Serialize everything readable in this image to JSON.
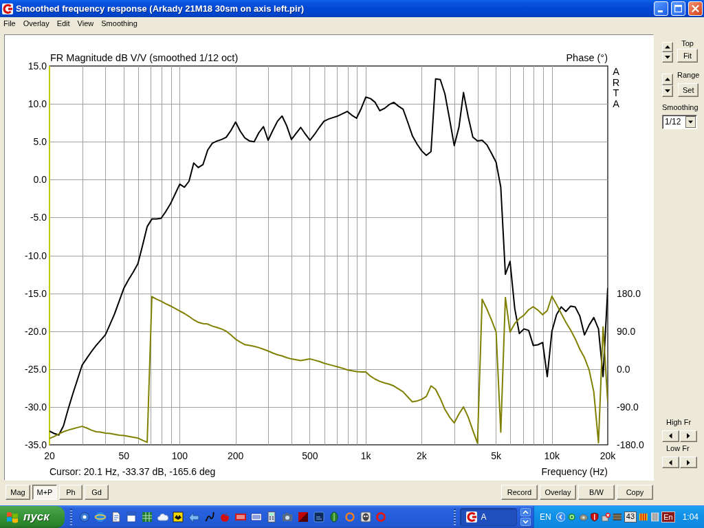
{
  "window": {
    "title": "Smoothed frequency response (Arkady 21M18 30sm on axis left.pir)"
  },
  "menu": [
    "File",
    "Overlay",
    "Edit",
    "View",
    "Smoothing"
  ],
  "chart": {
    "side_label": "ARTA",
    "cursor_readout": "Cursor: 20.1 Hz, -33.37 dB, -165.6 deg",
    "chart_data": {
      "type": "line",
      "title": "FR Magnitude dB V/V (smoothed 1/12 oct)",
      "xlabel": "Frequency (Hz)",
      "y2label": "Phase (°)",
      "grid": true,
      "categories": [
        "20",
        null,
        null,
        null,
        null,
        null,
        null,
        null,
        null,
        null,
        null,
        null,
        null,
        null,
        null,
        null,
        "50",
        null,
        null,
        null,
        null,
        null,
        null,
        null,
        null,
        null,
        null,
        null,
        "100",
        null,
        null,
        null,
        null,
        null,
        null,
        null,
        null,
        null,
        null,
        null,
        "200",
        null,
        null,
        null,
        null,
        null,
        null,
        null,
        null,
        null,
        null,
        null,
        null,
        null,
        null,
        null,
        "500",
        null,
        null,
        null,
        null,
        null,
        null,
        null,
        null,
        null,
        null,
        null,
        "1k",
        null,
        null,
        null,
        null,
        null,
        null,
        null,
        null,
        null,
        null,
        null,
        "2k",
        null,
        null,
        null,
        null,
        null,
        null,
        null,
        null,
        null,
        null,
        null,
        null,
        null,
        null,
        null,
        "5k",
        null,
        null,
        null,
        null,
        null,
        null,
        null,
        null,
        null,
        null,
        null,
        "10k",
        null,
        null,
        null,
        null,
        null,
        null,
        null,
        null,
        null,
        null,
        null,
        "20k"
      ],
      "series": [
        {
          "color": "#000000",
          "values": [
            -33.2,
            -33.5,
            -33.7,
            -32.5,
            -30.3,
            -28.3,
            -26.4,
            -24.5,
            -23.6,
            -22.7,
            -21.9,
            -21.2,
            -20.5,
            -19.1,
            -17.7,
            -16.0,
            -14.3,
            -13.2,
            -12.2,
            -11.1,
            -8.7,
            -6.2,
            -5.2,
            -5.2,
            -5.1,
            -4.2,
            -3.2,
            -1.9,
            -0.6,
            -1.0,
            -0.2,
            2.2,
            1.6,
            2.0,
            3.9,
            4.8,
            5.1,
            5.3,
            5.6,
            6.5,
            7.6,
            6.4,
            5.5,
            5.1,
            5.0,
            6.2,
            7.0,
            5.2,
            6.5,
            7.7,
            8.4,
            7.1,
            5.3,
            6.1,
            6.9,
            6.0,
            5.2,
            6.0,
            6.9,
            7.7,
            8.0,
            8.2,
            8.4,
            8.7,
            9.0,
            8.5,
            8.1,
            9.4,
            10.9,
            10.7,
            10.2,
            9.1,
            9.4,
            9.9,
            10.2,
            9.7,
            9.3,
            7.6,
            5.8,
            4.7,
            3.8,
            3.2,
            3.7,
            13.3,
            13.2,
            11.3,
            8.0,
            4.5,
            6.9,
            11.5,
            8.3,
            5.6,
            5.1,
            5.2,
            4.6,
            3.5,
            2.3,
            -1.0,
            -12.5,
            -10.8,
            -17.0,
            -20.3,
            -19.7,
            -19.9,
            -21.9,
            -21.8,
            -21.5,
            -26.0,
            -20.0,
            -17.8,
            -16.8,
            -17.4,
            -16.7,
            -16.8,
            -18.0,
            -20.5,
            -19.2,
            -18.2,
            -19.7,
            -26.0,
            -14.3
          ]
        },
        {
          "color": "#808000",
          "axis": "y2",
          "values": [
            -165,
            -160,
            -154,
            -149,
            -145,
            -142,
            -139,
            -136,
            -140,
            -145,
            -149,
            -150,
            -152,
            -153,
            -155,
            -157,
            -158,
            -160,
            -162,
            -164,
            -169,
            -174,
            172,
            166,
            161,
            155,
            150,
            144,
            138,
            132,
            125,
            117,
            111,
            108,
            107,
            102,
            99,
            95,
            90,
            81,
            71,
            64,
            58,
            56,
            54,
            51,
            47,
            43,
            38,
            34,
            31,
            27,
            24,
            22,
            20,
            22,
            24,
            21,
            18,
            14,
            11,
            8,
            5,
            2,
            -2,
            -4,
            -6,
            -7,
            -7,
            -17,
            -24,
            -29,
            -33,
            -36,
            -40,
            -47,
            -54,
            -66,
            -78,
            -76,
            -72,
            -65,
            -40,
            -48,
            -70,
            -96,
            -114,
            -128,
            -107,
            -90,
            -114,
            -146,
            -176,
            166,
            143,
            117,
            88,
            -150,
            170,
            88,
            108,
            120,
            128,
            141,
            148,
            140,
            129,
            139,
            173,
            153,
            132,
            111,
            93,
            72,
            47,
            27,
            -2,
            -54,
            -175,
            100,
            -79
          ]
        }
      ],
      "ylim": [
        -35,
        15
      ],
      "y2lim": [
        -180,
        720
      ],
      "yticks": [
        {
          "value": 15,
          "label": "15.0"
        },
        {
          "value": 10,
          "label": "10.0"
        },
        {
          "value": 5,
          "label": "5.0"
        },
        {
          "value": 0,
          "label": "0.0"
        },
        {
          "value": -5,
          "label": "-5.0"
        },
        {
          "value": -10,
          "label": "-10.0"
        },
        {
          "value": -15,
          "label": "-15.0"
        },
        {
          "value": -20,
          "label": "-20.0"
        },
        {
          "value": -25,
          "label": "-25.0"
        },
        {
          "value": -30,
          "label": "-30.0"
        },
        {
          "value": -35,
          "label": "-35.0"
        }
      ],
      "y2ticks": [
        {
          "value": 180,
          "label": "180.0"
        },
        {
          "value": 90,
          "label": "90.0"
        },
        {
          "value": 0,
          "label": "0.0"
        },
        {
          "value": -90,
          "label": "-90.0"
        },
        {
          "value": -180,
          "label": "-180.0"
        }
      ]
    }
  },
  "side_panel": {
    "top": {
      "label": "Top",
      "button": "Fit"
    },
    "range": {
      "label": "Range",
      "button": "Set"
    },
    "smoothing": {
      "label": "Smoothing",
      "value": "1/12"
    },
    "high_fr": {
      "label": "High Fr"
    },
    "low_fr": {
      "label": "Low Fr"
    }
  },
  "view_buttons": [
    {
      "label": "Mag",
      "selected": false
    },
    {
      "label": "M+P",
      "selected": true
    },
    {
      "label": "Ph",
      "selected": false
    },
    {
      "label": "Gd",
      "selected": false
    }
  ],
  "action_buttons": [
    "Record",
    "Overlay",
    "B/W",
    "Copy"
  ],
  "taskbar": {
    "start": "пуск",
    "tasks": [
      {
        "label": "A",
        "selected": true
      }
    ],
    "tray": {
      "language": "EN",
      "badge": "43",
      "layout": "En",
      "clock": "1:04"
    }
  }
}
